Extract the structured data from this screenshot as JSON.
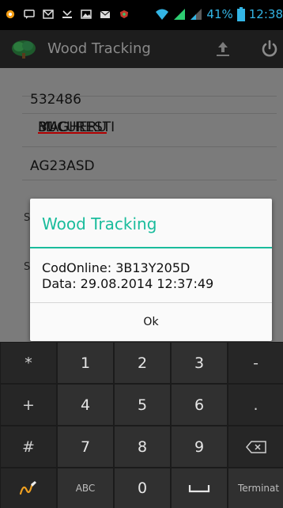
{
  "status_bar": {
    "battery": "41%",
    "time": "12:38"
  },
  "action_bar": {
    "title": "Wood Tracking",
    "upload_icon": "upload-icon",
    "power_icon": "power-icon"
  },
  "form": {
    "fields": [
      {
        "value": "532486"
      },
      {
        "value_prefix": "BUCURESTI ",
        "value_misspelled": "MAGHERU",
        "value_suffix": " 31"
      },
      {
        "value": "AG23ASD"
      }
    ],
    "hidden_label_1": "S",
    "hidden_label_2": "S"
  },
  "dialog": {
    "title": "Wood Tracking",
    "message_line1": "CodOnline: 3B13Y205D",
    "message_line2": "Data: 29.08.2014 12:37:49",
    "ok_label": "Ok"
  },
  "keyboard": {
    "rows": [
      [
        "*",
        "1",
        "2",
        "3",
        "-"
      ],
      [
        "+",
        "4",
        "5",
        "6",
        "."
      ],
      [
        "#",
        "7",
        "8",
        "9",
        "⌫"
      ],
      [
        "✍",
        "ABC",
        "0",
        "␣",
        "Terminat"
      ]
    ]
  },
  "colors": {
    "accent": "#1abc9c",
    "status_blue": "#33b5e5"
  }
}
